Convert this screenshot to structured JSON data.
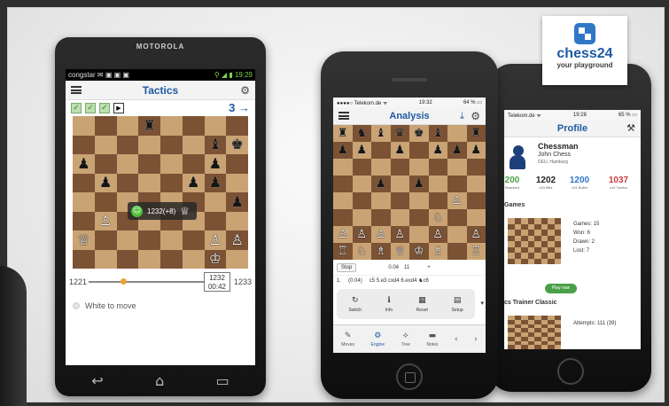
{
  "logo": {
    "name": "chess24",
    "tagline": "your playground"
  },
  "phone1": {
    "brand": "MOTOROLA",
    "status": {
      "carrier": "congstar",
      "icons": "✉ ▣ ▣ ▣",
      "right": "⚲ ◢ ▮ 19:29"
    },
    "app_title": "Tactics",
    "checks": [
      "✓",
      "✓",
      "✓"
    ],
    "play_icon": "▶",
    "counter": "3 →",
    "board": [
      [
        "",
        "",
        "",
        "♜",
        "",
        "",
        "",
        ""
      ],
      [
        "",
        "",
        "",
        "",
        "",
        "",
        "♝",
        "♚"
      ],
      [
        "♟",
        "",
        "",
        "",
        "",
        "",
        "♟",
        ""
      ],
      [
        "",
        "♟",
        "",
        "",
        "",
        "♟",
        "♟",
        ""
      ],
      [
        "",
        "",
        "",
        "",
        "",
        "",
        "",
        "♟"
      ],
      [
        "",
        "♙",
        "",
        "",
        "",
        "",
        "",
        ""
      ],
      [
        "♕",
        "",
        "",
        "",
        "",
        "",
        "♙",
        "♙"
      ],
      [
        "",
        "",
        "",
        "",
        "",
        "",
        "♔",
        ""
      ]
    ],
    "popup": {
      "smiley": "☺",
      "rating": "1232(+8)",
      "queen": "♕"
    },
    "rating": {
      "min": "1221",
      "max": "1233",
      "current": "1232",
      "time": "00:42"
    },
    "move_text": "White to move",
    "nav_icons": [
      "↩",
      "⌂",
      "▭"
    ]
  },
  "phone2": {
    "status": {
      "left": "●●●●○ Telekom.de ᯤ",
      "time": "19:32",
      "right": "64 % ▭"
    },
    "app_title": "Analysis",
    "download_icon": "⤓",
    "board": [
      [
        "♜",
        "♞",
        "♝",
        "♛",
        "♚",
        "♝",
        "",
        "♜"
      ],
      [
        "♟",
        "♟",
        "",
        "♟",
        "",
        "♟",
        "♟",
        "♟"
      ],
      [
        "",
        "",
        "",
        "",
        "",
        "",
        "",
        ""
      ],
      [
        "",
        "",
        "♟",
        "",
        "♟",
        "",
        "",
        ""
      ],
      [
        "",
        "",
        "",
        "",
        "",
        "",
        "♙",
        ""
      ],
      [
        "",
        "",
        "",
        "",
        "",
        "♘",
        "",
        ""
      ],
      [
        "♙",
        "♙",
        "♙",
        "♙",
        "",
        "♙",
        "",
        "♙"
      ],
      [
        "♖",
        "♘",
        "♗",
        "♕",
        "♔",
        "♗",
        "",
        "♖"
      ]
    ],
    "controls": {
      "stop": "Stop",
      "eval": "0.04",
      "lines": "11",
      "plus": "+"
    },
    "line": {
      "index": "1.",
      "eval": "(0.04)",
      "moves": "c5 5.e3 cxd4 6.exd4 ♞c6"
    },
    "tools": [
      {
        "icon": "↻",
        "label": "Switch"
      },
      {
        "icon": "ℹ",
        "label": "Info"
      },
      {
        "icon": "▦",
        "label": "Reset"
      },
      {
        "icon": "▤",
        "label": "Setup"
      }
    ],
    "more_icon": "▾",
    "tabs": [
      {
        "icon": "✎",
        "label": "Moves"
      },
      {
        "icon": "⚙",
        "label": "Engine"
      },
      {
        "icon": "⟡",
        "label": "Tree"
      },
      {
        "icon": "▬",
        "label": "Notes"
      },
      {
        "icon": "‹",
        "label": ""
      },
      {
        "icon": "›",
        "label": ""
      }
    ]
  },
  "phone3": {
    "status": {
      "left": "Telekom.de ᯤ",
      "time": "19:28",
      "right": "65 % ▭"
    },
    "app_title": "Profile",
    "tools_icon": "⚒",
    "user": {
      "name": "Chessman",
      "real_name": "John Chess",
      "location": "DEU, Hamburg"
    },
    "ratings": [
      {
        "value": "200",
        "label": "Standard",
        "color": "#4ba04a"
      },
      {
        "value": "1202",
        "label": "c24 Blitz",
        "color": "#222222"
      },
      {
        "value": "1200",
        "label": "c24 Bullet",
        "color": "#2f78c8"
      },
      {
        "value": "1037",
        "label": "c24 Tactics",
        "color": "#c63c3c"
      }
    ],
    "games_heading": "Games",
    "stats": {
      "games": "Games: 15",
      "won": "Won: 6",
      "drawn": "Drawn: 2",
      "lost": "Lost: 7"
    },
    "play_button": "Play now",
    "trainer_heading": "cs Trainer Classic",
    "attempts": "Attempts: 111 (39)"
  }
}
